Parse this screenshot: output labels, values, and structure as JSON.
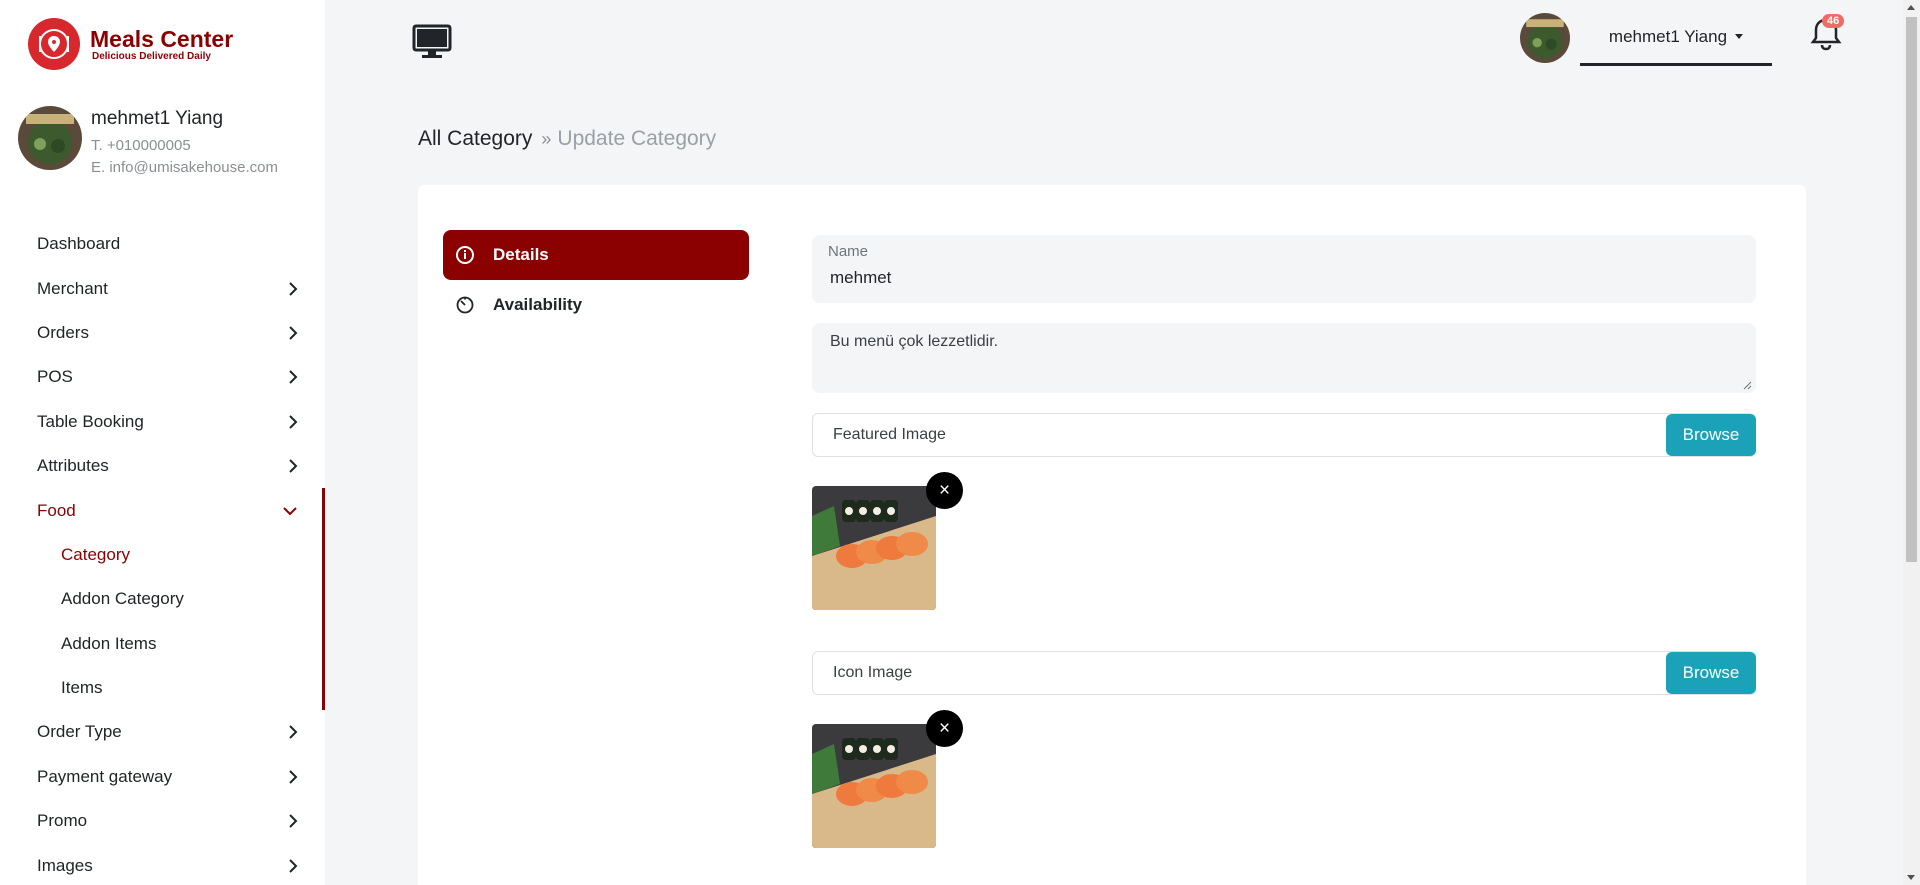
{
  "brand": {
    "title": "Meals Center",
    "tagline": "Delicious Delivered Daily",
    "color": "#8b0000"
  },
  "profile": {
    "name": "mehmet1 Yiang",
    "phone": "T. +010000005",
    "email": "E. info@umisakehouse.com"
  },
  "sidebar": {
    "items": [
      {
        "label": "Dashboard"
      },
      {
        "label": "Merchant"
      },
      {
        "label": "Orders"
      },
      {
        "label": "POS"
      },
      {
        "label": "Table Booking"
      },
      {
        "label": "Attributes"
      },
      {
        "label": "Food"
      },
      {
        "label": "Order Type"
      },
      {
        "label": "Payment gateway"
      },
      {
        "label": "Promo"
      },
      {
        "label": "Images"
      }
    ],
    "food_sub": [
      {
        "label": "Category"
      },
      {
        "label": "Addon Category"
      },
      {
        "label": "Addon Items"
      },
      {
        "label": "Items"
      }
    ]
  },
  "topbar": {
    "user_name": "mehmet1 Yiang",
    "notification_count": "46"
  },
  "breadcrumb": {
    "parent": "All Category",
    "separator": "»",
    "current": "Update Category"
  },
  "tabs": [
    {
      "label": "Details"
    },
    {
      "label": "Availability"
    }
  ],
  "form": {
    "name_label": "Name",
    "name_value": "mehmet",
    "description": "Bu menü çok lezzetlidir.",
    "featured_label": "Featured Image",
    "icon_label": "Icon Image",
    "browse_label": "Browse",
    "remove_symbol": "×"
  },
  "colors": {
    "accent": "#8b0000",
    "browse": "#1ba2b8",
    "badge": "#f06b66"
  }
}
